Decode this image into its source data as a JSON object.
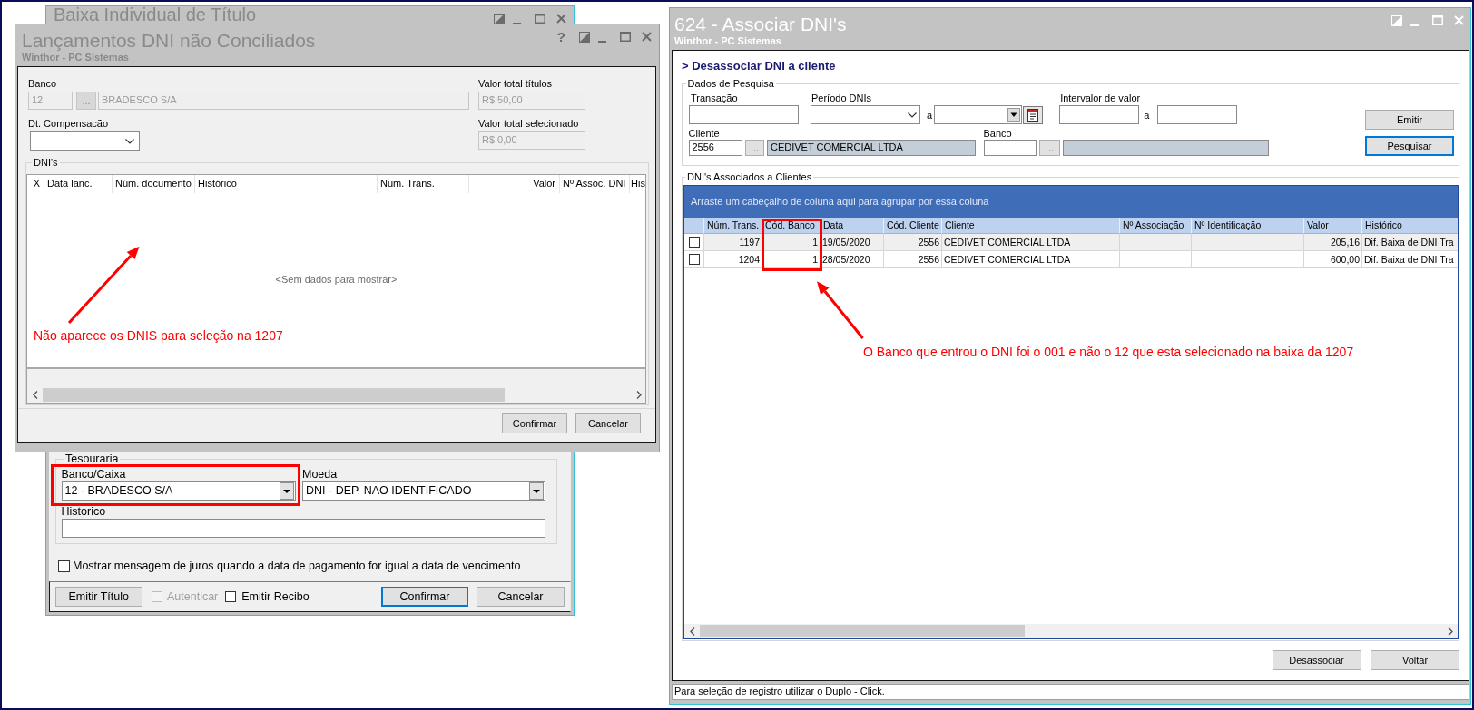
{
  "baixa_window": {
    "title": "Baixa Individual de Título",
    "active": false,
    "tesouraria": {
      "legend": "Tesouraria",
      "banco_caixa": {
        "label": "Banco/Caixa",
        "value": "12 - BRADESCO S/A"
      },
      "moeda": {
        "label": "Moeda",
        "value": "DNI - DEP. NAO IDENTIFICADO"
      },
      "historico": {
        "label": "Historico"
      }
    },
    "juros_option": {
      "label": "Mostrar mensagem de juros quando a data de pagamento for igual a data de vencimento",
      "checked": false
    },
    "emitir_titulo_button": {
      "label": "Emitir Título",
      "focused": false
    },
    "options": [
      {
        "label": "Autenticar",
        "checked": false,
        "disabled": true
      },
      {
        "label": "Emitir Recibo",
        "checked": false,
        "disabled": false
      }
    ],
    "buttons": [
      {
        "label": "Confirmar",
        "focused": true
      },
      {
        "label": "Cancelar",
        "focused": false
      }
    ]
  },
  "lancamentos_window": {
    "title": "Lançamentos DNI não Conciliados",
    "subtitle": "Winthor - PC Sistemas",
    "active": false,
    "help": "?",
    "banco": {
      "label": "Banco",
      "code": "12",
      "lookup": "...",
      "name": "BRADESCO S/A",
      "disabled": true
    },
    "valor_total_titulos": {
      "label": "Valor total títulos",
      "value": "R$ 50,00",
      "disabled": true
    },
    "dt_compensacao": {
      "label": "Dt. Compensacão",
      "disabled": false
    },
    "valor_total_selecionado": {
      "label": "Valor total selecionado",
      "value": "R$ 0,00",
      "disabled": true
    },
    "dnis": {
      "legend": "DNI's",
      "columns": [
        {
          "label": "X",
          "kind": "check"
        },
        {
          "label": "Data lanc.",
          "kind": "text"
        },
        {
          "label": "Núm. documento",
          "kind": "text"
        },
        {
          "label": "Histórico",
          "kind": "text"
        },
        {
          "label": "Num. Trans.",
          "kind": "text"
        },
        {
          "label": "Valor",
          "kind": "number"
        },
        {
          "label": "Nº Assoc. DNI",
          "kind": "text"
        },
        {
          "label": "His",
          "kind": "text"
        }
      ],
      "empty_message": "<Sem dados para mostrar>"
    },
    "buttons": [
      {
        "label": "Confirmar",
        "focused": false
      },
      {
        "label": "Cancelar",
        "focused": false
      }
    ]
  },
  "associar_window": {
    "title": "624 - Associar DNI's",
    "subtitle": "Winthor - PC Sistemas",
    "active": true,
    "heading": "> Desassociar DNI a cliente",
    "search": {
      "legend": "Dados de Pesquisa",
      "transacao": {
        "label": "Transação"
      },
      "periodo": {
        "label": "Período DNIs",
        "separator": "a"
      },
      "intervalo": {
        "label": "Intervalor de valor",
        "separator": "a"
      },
      "cliente": {
        "label": "Cliente",
        "code": "2556",
        "lookup": "...",
        "name": "CEDIVET COMERCIAL LTDA"
      },
      "banco": {
        "label": "Banco",
        "lookup": "..."
      },
      "buttons": [
        {
          "label": "Emitir",
          "focused": false
        },
        {
          "label": "Pesquisar",
          "focused": true
        }
      ]
    },
    "results": {
      "legend": "DNI's Associados a Clientes",
      "group_hint": "Arraste um cabeçalho de coluna aqui para agrupar por essa coluna",
      "columns": [
        {
          "kind": "check"
        },
        {
          "label": "Núm. Trans.",
          "kind": "number"
        },
        {
          "label": "Cód. Banco",
          "kind": "number"
        },
        {
          "label": "Data",
          "kind": "text"
        },
        {
          "label": "Cód. Cliente",
          "kind": "number"
        },
        {
          "label": "Cliente",
          "kind": "text"
        },
        {
          "label": "Nº Associação",
          "kind": "text"
        },
        {
          "label": "Nº Identificação",
          "kind": "text"
        },
        {
          "label": "Valor",
          "kind": "number"
        },
        {
          "label": "Histórico",
          "kind": "text"
        }
      ],
      "rows": [
        {
          "checked": false,
          "selected": true,
          "cells": [
            null,
            "1197",
            "1",
            "19/05/2020",
            "2556",
            "CEDIVET COMERCIAL LTDA",
            null,
            null,
            "205,16",
            "Dif. Baixa de DNI Tra"
          ]
        },
        {
          "checked": false,
          "selected": false,
          "cells": [
            null,
            "1204",
            "1",
            "28/05/2020",
            "2556",
            "CEDIVET COMERCIAL LTDA",
            null,
            null,
            "600,00",
            "Dif. Baixa de DNI Tra"
          ]
        }
      ]
    },
    "buttons": [
      {
        "label": "Desassociar",
        "focused": false
      },
      {
        "label": "Voltar",
        "focused": false
      }
    ],
    "status_bar": "Para seleção de registro utilizar o Duplo - Click."
  },
  "annotations": [
    {
      "text": "Não aparece os DNIS para seleção na 1207"
    },
    {
      "text": "O Banco que entrou o DNI foi o 001 e não o 12 que esta selecionado na baixa da 1207"
    }
  ]
}
